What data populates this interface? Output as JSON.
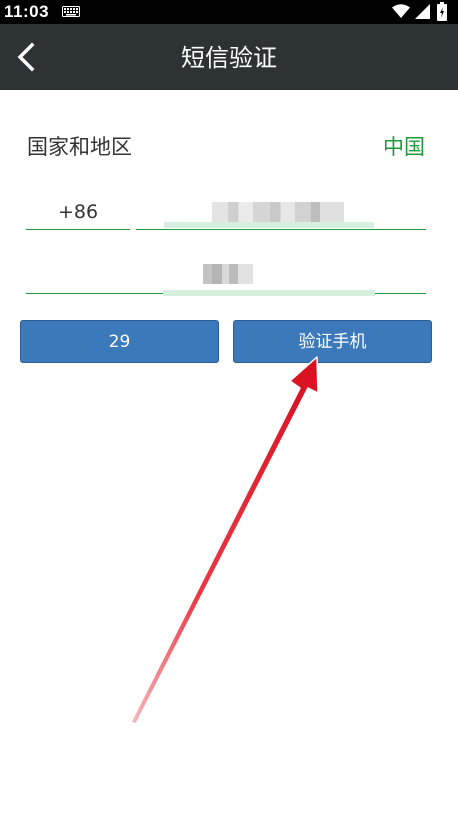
{
  "status_bar": {
    "time": "11:03"
  },
  "top_bar": {
    "title": "短信验证"
  },
  "region": {
    "label": "国家和地区",
    "value": "中国"
  },
  "phone": {
    "country_code": "+86"
  },
  "buttons": {
    "countdown_label": "29",
    "verify_label": "验证手机"
  },
  "colors": {
    "top_bar_bg": "#2d3235",
    "accent_green": "#1f9a3c",
    "button_blue": "#3b79bb",
    "annotation_arrow": "#e8192c"
  },
  "icons": {
    "back": "chevron-left-icon",
    "keyboard": "keyboard-icon",
    "wifi": "wifi-icon",
    "signal": "signal-icon",
    "battery": "battery-icon"
  }
}
